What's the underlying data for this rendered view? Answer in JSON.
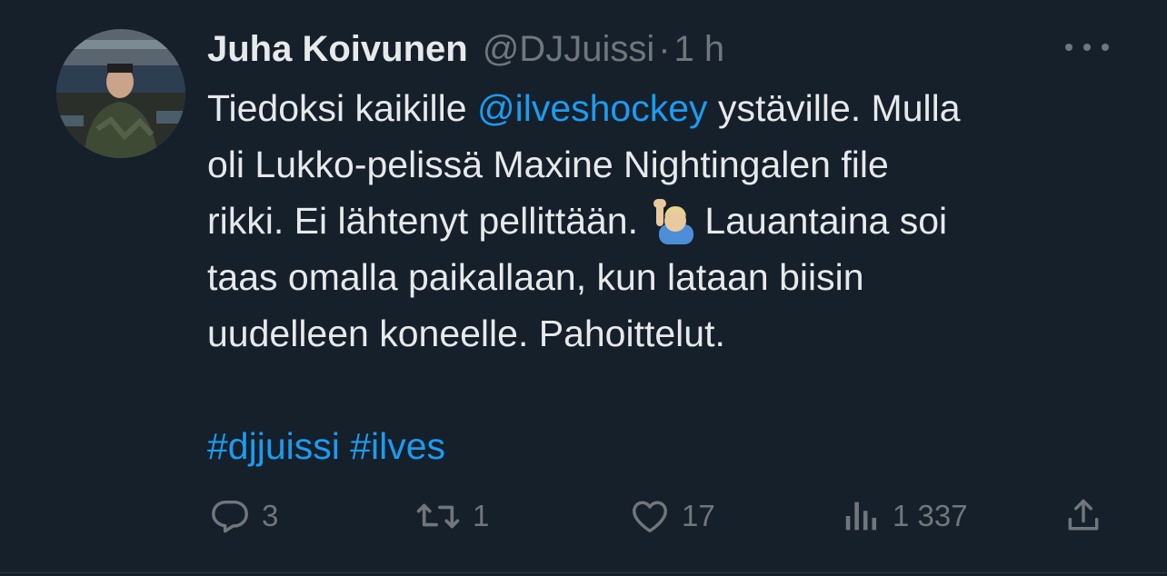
{
  "author": {
    "name": "Juha Koivunen",
    "handle": "@DJJuissi",
    "separator": "·",
    "time": "1 h"
  },
  "tweet": {
    "line1_a": "Tiedoksi kaikille ",
    "line1_mention": "@ilveshockey",
    "line1_b": " ystäville. Mulla",
    "line2": "oli Lukko-pelissä Maxine Nightingalen file",
    "line3_a": "rikki. Ei lähtenyt pellittään.",
    "line3_b": "Lauantaina soi",
    "line4": "taas omalla paikallaan, kun lataan biisin",
    "line5": "uudelleen koneelle. Pahoittelut.",
    "hashtags": "#djjuissi #ilves",
    "emoji": "raising-hand-emoji"
  },
  "actions": {
    "replies": "3",
    "retweets": "1",
    "likes": "17",
    "views": "1 337"
  },
  "colors": {
    "background": "#15202b",
    "text": "#e7e9ea",
    "muted": "#71767b",
    "link": "#1d9bf0"
  }
}
